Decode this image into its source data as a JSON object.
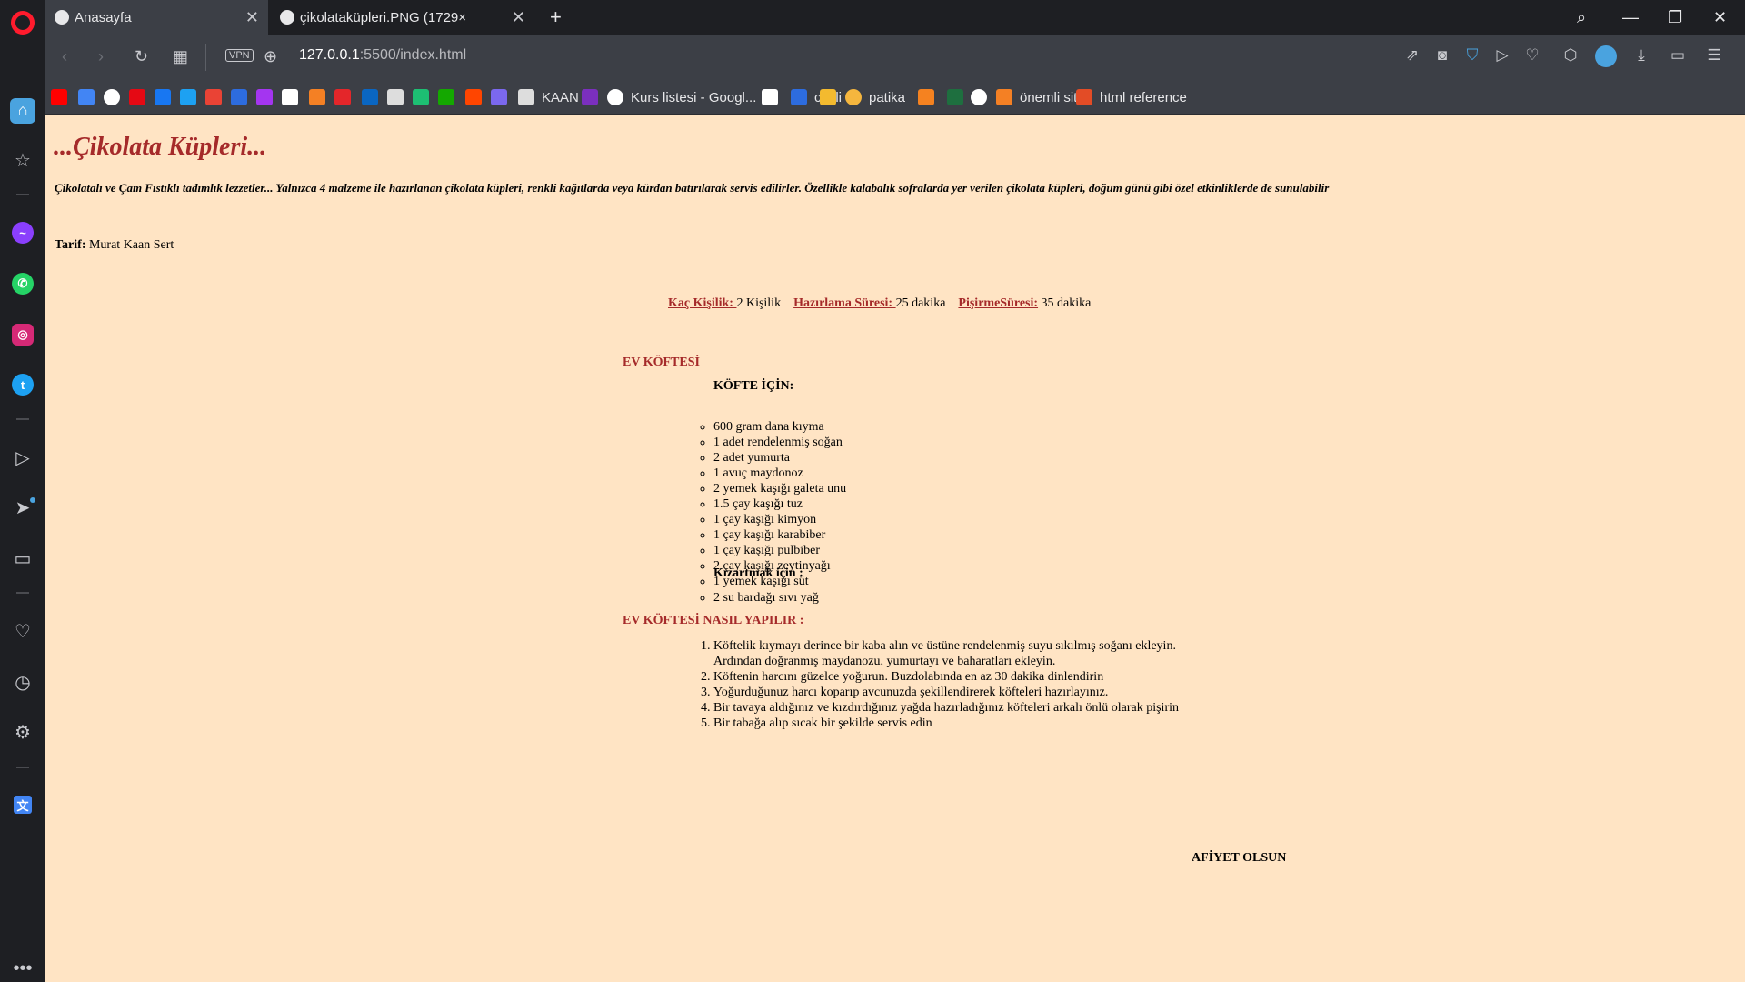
{
  "browser": {
    "tabs": [
      {
        "title": "Anasayfa",
        "active": true
      },
      {
        "title": "çikolataküpleri.PNG (1729×"
      }
    ],
    "new_tab": "+",
    "url_host": "127.0.0.1",
    "url_rest": ":5500/index.html",
    "vpn_label": "VPN",
    "bookmarks": [
      {
        "label": "",
        "icon": "youtube-icon",
        "color": "#ff0000"
      },
      {
        "label": "",
        "icon": "translate-icon",
        "color": "#4285f4"
      },
      {
        "label": "",
        "icon": "google-icon",
        "color": "#ffffff"
      },
      {
        "label": "",
        "icon": "netflix-icon",
        "color": "#e50914"
      },
      {
        "label": "",
        "icon": "facebook-icon",
        "color": "#1877f2"
      },
      {
        "label": "",
        "icon": "twitter-icon",
        "color": "#1da1f2"
      },
      {
        "label": "",
        "icon": "gmail-icon",
        "color": "#ea4335"
      },
      {
        "label": "",
        "icon": "site-icon",
        "color": "#2d6cdf"
      },
      {
        "label": "",
        "icon": "udemy-icon",
        "color": "#a435f0"
      },
      {
        "label": "",
        "icon": "amazon-icon",
        "color": "#ffffff"
      },
      {
        "label": "",
        "icon": "site-icon",
        "color": "#f48024"
      },
      {
        "label": "",
        "icon": "site-icon",
        "color": "#e4262a"
      },
      {
        "label": "",
        "icon": "linkedin-icon",
        "color": "#0a66c2"
      },
      {
        "label": "",
        "icon": "btk-icon",
        "color": "#dddddd"
      },
      {
        "label": "",
        "icon": "fiverr-icon",
        "color": "#1dbf73"
      },
      {
        "label": "",
        "icon": "upwork-icon",
        "color": "#14a800"
      },
      {
        "label": "",
        "icon": "reddit-icon",
        "color": "#ff4500"
      },
      {
        "label": "",
        "icon": "site-icon",
        "color": "#7b68ee"
      },
      {
        "label": "KAAN",
        "icon": "document-icon",
        "color": "#dddddd"
      },
      {
        "label": "",
        "icon": "k-icon",
        "color": "#7b2fbe"
      },
      {
        "label": "Kurs listesi - Googl...",
        "icon": "google-icon",
        "color": "#ffffff"
      },
      {
        "label": "",
        "icon": "code-icon",
        "color": "#ffffff"
      },
      {
        "label": "c dili",
        "icon": "c-icon",
        "color": "#2d6cdf"
      },
      {
        "label": "",
        "icon": "binance-icon",
        "color": "#f3ba2f"
      },
      {
        "label": "patika",
        "icon": "patika-icon",
        "color": "#f5b63e"
      },
      {
        "label": "",
        "icon": "rocket-icon",
        "color": "#f58220"
      },
      {
        "label": "",
        "icon": "site-icon",
        "color": "#1e6f3f"
      },
      {
        "label": "",
        "icon": "github-icon",
        "color": "#ffffff"
      },
      {
        "label": "önemli site",
        "icon": "stackoverflow-icon",
        "color": "#f48024"
      },
      {
        "label": "html reference",
        "icon": "site-icon",
        "color": "#e34c26"
      }
    ]
  },
  "page": {
    "title": "...Çikolata Küpleri...",
    "intro": "Çikolatalı ve Çam Fıstıklı tadımlık lezzetler... Yalnızca 4 malzeme ile hazırlanan çikolata küpleri, renkli kağıtlarda veya kürdan batırılarak servis edilirler. Özellikle kalabalık sofralarda yer verilen çikolata küpleri, doğum günü gibi özel etkinliklerde de sunulabilir",
    "tarif_label": "Tarif:",
    "tarif_value": "Murat Kaan Sert",
    "meta": {
      "people_label": "Kaç Kişilik: ",
      "people_value": "2 Kişilik",
      "prep_label": "Hazırlama Süresi: ",
      "prep_value": "25 dakika",
      "cook_label": "PişirmeSüresi:",
      "cook_value": "35 dakika"
    },
    "section1_title": "EV KÖFTESİ",
    "kofte_title": "KÖFTE İÇİN:",
    "ingredients": [
      "600 gram dana kıyma",
      "1 adet rendelenmiş soğan",
      "2 adet yumurta",
      "1 avuç maydonoz",
      "2 yemek kaşığı galeta unu",
      "1.5 çay kaşığı tuz",
      "1 çay kaşığı kimyon",
      "1 çay kaşığı karabiber",
      "1 çay kaşığı pulbiber",
      "2 çay kaşığı zeytinyağı",
      "1 yemek kaşığı süt"
    ],
    "fry_title": "Kızartmak için :",
    "fry_items": [
      "2 su bardağı sıvı yağ"
    ],
    "section2_title": "EV KÖFTESİ NASIL YAPILIR :",
    "steps": [
      "Köftelik kıymayı derince bir kaba alın ve üstüne rendelenmiş suyu sıkılmış soğanı ekleyin. Ardından doğranmış maydanozu, yumurtayı ve baharatları ekleyin.",
      "Köftenin harcını güzelce yoğurun. Buzdolabında en az 30 dakika dinlendirin",
      "Yoğurduğunuz harcı koparıp avcunuzda şekillendirerek köfteleri hazırlayınız.",
      "Bir tavaya aldığınız ve kızdırdığınız yağda hazırladığınız köfteleri arkalı önlü olarak pişirin",
      "Bir tabağa alıp sıcak bir şekilde servis edin"
    ],
    "closing": "AFİYET OLSUN"
  }
}
